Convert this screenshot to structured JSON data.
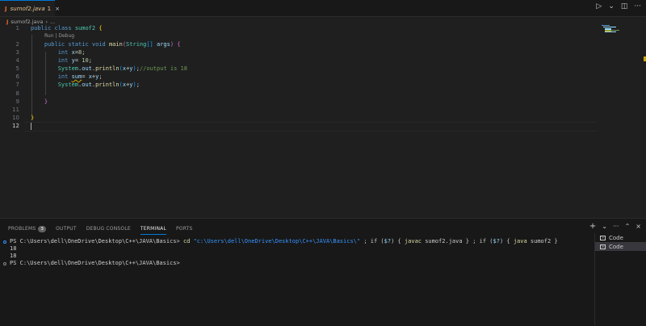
{
  "tab": {
    "icon": "J",
    "filename": "sumof2.java",
    "dirty": "1",
    "close": "×"
  },
  "tab_actions": {
    "run": "▷",
    "run_menu": "⌄",
    "split": "◫",
    "more": "···"
  },
  "breadcrumb": {
    "icon": "J",
    "file": "sumof2.java",
    "sep": "›",
    "rest": "..."
  },
  "editor": {
    "code_lens": "Run | Debug",
    "line_numbers": [
      "1",
      "2",
      "3",
      "4",
      "5",
      "6",
      "7",
      "8",
      "9",
      "10",
      "11",
      "12"
    ]
  },
  "panel": {
    "tabs": [
      "PROBLEMS",
      "OUTPUT",
      "DEBUG CONSOLE",
      "TERMINAL",
      "PORTS"
    ],
    "problems_count": "3",
    "actions": {
      "add": "+",
      "add_menu": "⌄",
      "more": "···",
      "maximize": "⌃",
      "close": "×"
    }
  },
  "terminal": {
    "line1": {
      "prompt": "PS C:\\Users\\dell\\OneDrive\\Desktop\\C++\\JAVA\\Basics> ",
      "cd": "cd",
      "path": "\"c:\\Users\\dell\\OneDrive\\Desktop\\C++\\JAVA\\Basics\\\"",
      "p2": " ; if (",
      "v1": "$?",
      "p3": ") { ",
      "javac": "javac",
      "p4": " sumof2.java } ; if (",
      "v2": "$?",
      "p5": ") { ",
      "java": "java",
      "p6": " sumof2 }"
    },
    "out1": "18",
    "out2": "18",
    "prompt2": "PS C:\\Users\\dell\\OneDrive\\Desktop\\C++\\JAVA\\Basics>"
  },
  "terminal_list": [
    {
      "label": "Code",
      "icon": "terminal-icon"
    },
    {
      "label": "Code",
      "icon": "terminal-icon"
    }
  ]
}
